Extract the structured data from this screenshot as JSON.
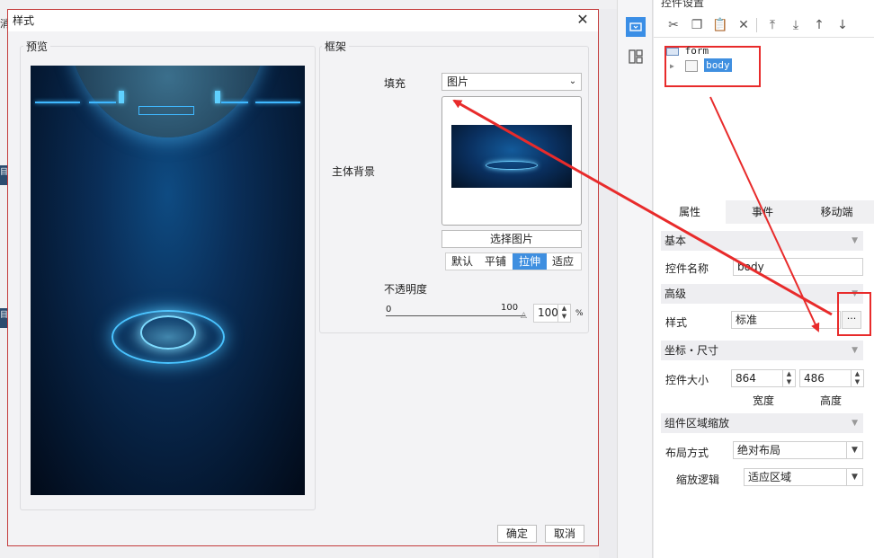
{
  "background_app": {
    "left_tab_1": "目",
    "left_tab_2": "目",
    "left_cut_text": "消"
  },
  "dialog": {
    "title": "样式",
    "preview_label": "预览",
    "frame_label": "框架",
    "main_bg_label": "主体背景",
    "fill_label": "填充",
    "fill_value": "图片",
    "choose_image_button": "选择图片",
    "modes": [
      "默认",
      "平铺",
      "拉伸",
      "适应"
    ],
    "active_mode_index": 2,
    "opacity_label": "不透明度",
    "slider_min": "0",
    "slider_max": "100",
    "opacity_value": "100",
    "opacity_unit": "%",
    "opacity_fraction": 1.0,
    "ok_button": "确定",
    "cancel_button": "取消"
  },
  "right_panel": {
    "title": "控件设置",
    "tree": {
      "root": "form",
      "child": "body"
    },
    "tabs": [
      "属性",
      "事件",
      "移动端"
    ],
    "active_tab_index": 0,
    "sections": {
      "basic": "基本",
      "advanced": "高级",
      "coords": "坐标・尺寸",
      "scale": "组件区域缩放"
    },
    "control_name_label": "控件名称",
    "control_name_value": "body",
    "style_label": "样式",
    "style_value": "标准",
    "style_more": "···",
    "size_label": "控件大小",
    "width_value": "864",
    "height_value": "486",
    "width_label": "宽度",
    "height_label": "高度",
    "layout_label": "布局方式",
    "layout_value": "绝对布局",
    "scale_logic_label": "缩放逻辑",
    "scale_logic_value": "适应区域"
  },
  "colors": {
    "accent": "#3f8fe0",
    "annotation_red": "#e82b2b",
    "dialog_border": "#c43c3c"
  }
}
